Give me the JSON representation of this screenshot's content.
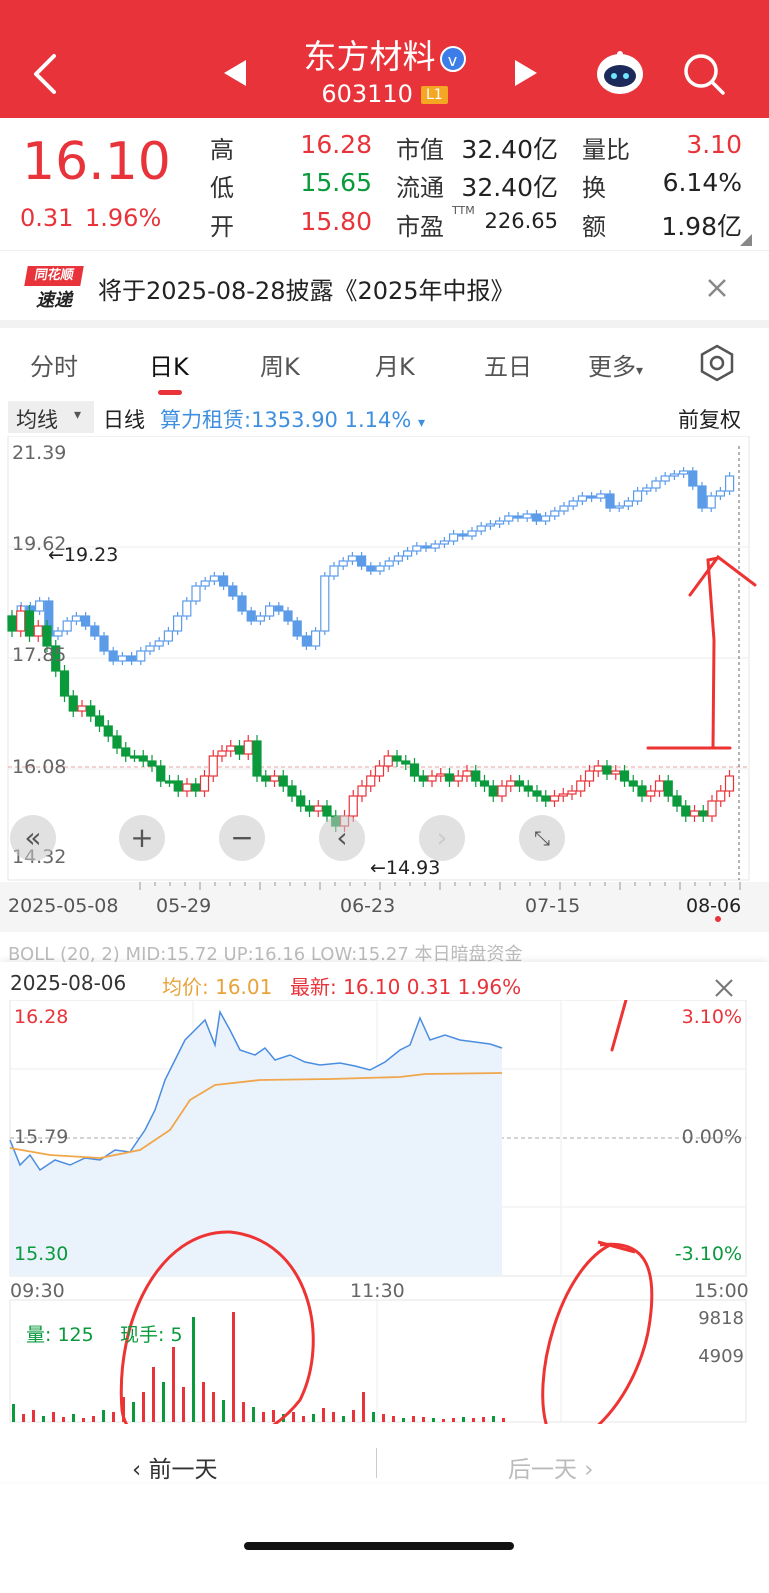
{
  "header": {
    "stock_name": "东方材料",
    "stock_code": "603110",
    "level_badge": "L1",
    "verified_icon": "v"
  },
  "quote": {
    "price": "16.10",
    "change": "0.31",
    "change_pct": "1.96%",
    "high_label": "高",
    "high": "16.28",
    "low_label": "低",
    "low": "15.65",
    "open_label": "开",
    "open": "15.80",
    "mktcap_label": "市值",
    "mktcap": "32.40亿",
    "float_label": "流通",
    "float": "32.40亿",
    "pe_label": "市盈",
    "pe_sup": "TTM",
    "pe": "226.65",
    "vol_ratio_label": "量比",
    "vol_ratio": "3.10",
    "turnover_label": "换",
    "turnover": "6.14%",
    "amount_label": "额",
    "amount": "1.98亿"
  },
  "notice": {
    "logo_top": "同花顺",
    "logo_bottom": "速递",
    "text": "将于2025-08-28披露《2025年中报》"
  },
  "tabs": [
    "分时",
    "日K",
    "周K",
    "月K",
    "五日",
    "更多"
  ],
  "indicator_bar": {
    "ma_select": "均线",
    "period": "日线",
    "sector_info": "算力租赁:1353.90  1.14%",
    "adjust": "前复权"
  },
  "kline": {
    "y_labels": [
      "21.39",
      "19.62",
      "17.85",
      "16.08",
      "14.32"
    ],
    "high_mark": "←19.23",
    "low_mark": "←14.93",
    "x_labels": [
      "2025-05-08",
      "05-29",
      "06-23",
      "07-15",
      "08-06"
    ],
    "sub_bar": "BOLL  (20, 2)  MID:15.72  UP:16.16  LOW:15.27  本日暗盘资金"
  },
  "intraday": {
    "date": "2025-08-06",
    "avg_label": "均价: 16.01",
    "latest_label": "最新: 16.10  0.31  1.96%",
    "y_left": [
      "16.28",
      "15.79",
      "15.30"
    ],
    "y_right": [
      "3.10%",
      "0.00%",
      "-3.10%"
    ],
    "x_labels": [
      "09:30",
      "11:30",
      "15:00"
    ],
    "vol_label": "量: 125",
    "hand_label": "现手: 5",
    "vol_ticks": [
      "9818",
      "4909"
    ]
  },
  "footer": {
    "prev_day": "前一天",
    "next_day": "后一天"
  },
  "colors": {
    "up": "#e8333a",
    "down": "#0a9a3c",
    "header": "#e8333a",
    "overlay": "#5b9be8"
  }
}
